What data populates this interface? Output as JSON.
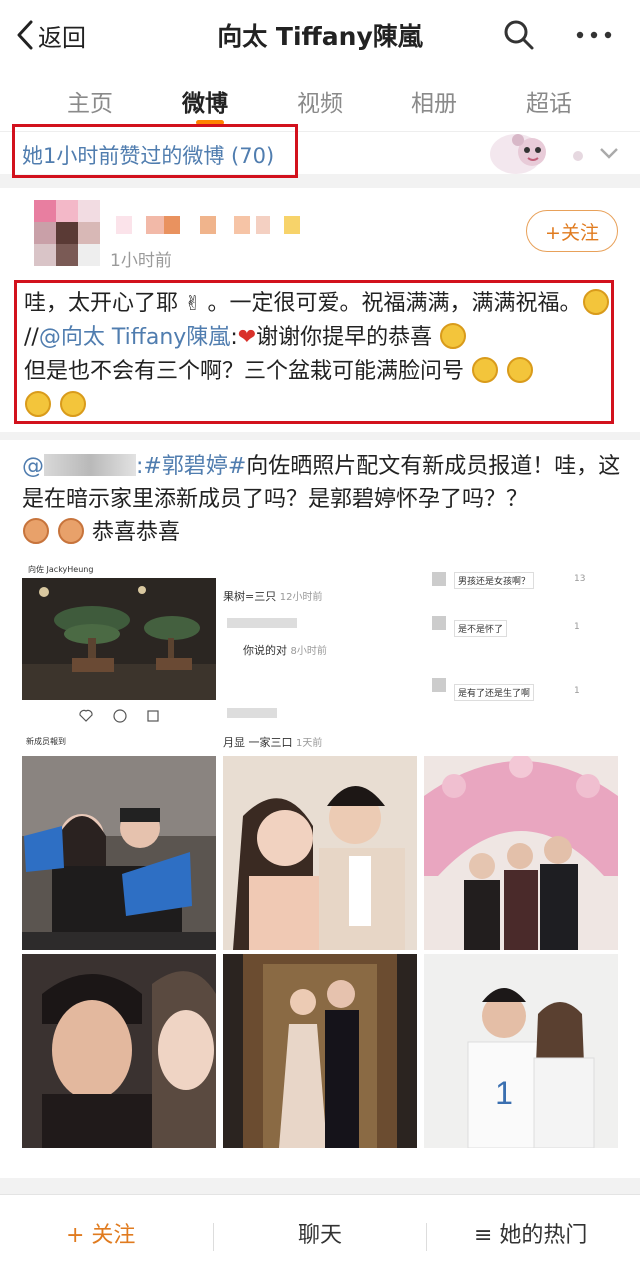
{
  "nav": {
    "back_label": "返回",
    "title": "向太 Tiffany陳嵐"
  },
  "tabs": [
    {
      "label": "主页"
    },
    {
      "label": "微博"
    },
    {
      "label": "视频"
    },
    {
      "label": "相册"
    },
    {
      "label": "超话"
    }
  ],
  "active_tab": "微博",
  "liked_strip": {
    "text": "她1小时前赞过的微博 (70)"
  },
  "post1": {
    "time": "1小时前",
    "follow_label": "+关注",
    "text_a": "哇，太开心了耶",
    "text_b": "。一定很可爱。祝福满满，满满祝福。",
    "repost_prefix": "//",
    "repost_mention": "@向太 Tiffany陳嵐",
    "text_c": ":",
    "text_d": "谢谢你提早的恭喜",
    "text_e": "但是也不会有三个啊？三个盆栽可能满脸问号"
  },
  "post2": {
    "hashtag": ":#郭碧婷#",
    "text": "向佐晒照片配文有新成员报道！哇，这是在暗示家里添新成员了吗？是郭碧婷怀孕了吗？？",
    "text_end": "恭喜恭喜",
    "images": [
      {
        "caption_top": "向佐 JackyHeung",
        "caption_bottom": "新成员報到"
      },
      {
        "line1": "果树=三只",
        "line1_time": "12小时前",
        "line2": "你说的对",
        "line2_time": "8小时前",
        "line3": "月显 一家三口",
        "line3_time": "1天前"
      },
      {
        "c1": "男孩还是女孩啊？",
        "c1_count": "13",
        "c2": "是不是怀了",
        "c2_count": "1",
        "c3": "是有了还是生了啊",
        "c3_count": "1"
      },
      {},
      {},
      {},
      {},
      {},
      {}
    ]
  },
  "bottom_bar": {
    "follow": "+ 关注",
    "chat": "聊天",
    "hot": "≡ 她的热门"
  },
  "colors": {
    "accent_orange": "#ff8200",
    "link_blue": "#507daf",
    "highlight_red": "#d2111d"
  }
}
